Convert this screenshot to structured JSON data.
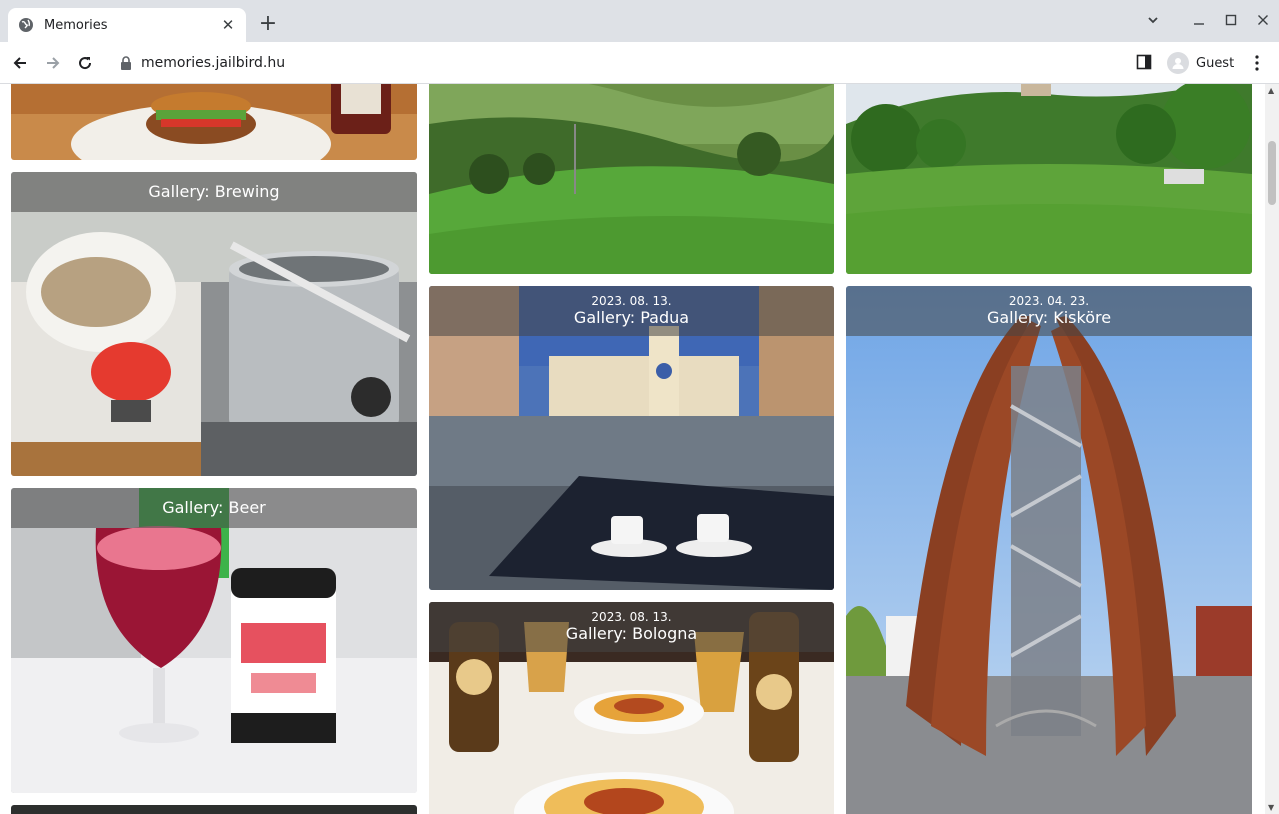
{
  "browser": {
    "tab_title": "Memories",
    "url": "memories.jailbird.hu",
    "profile_name": "Guest",
    "new_tab_label": "+",
    "close_tab_label": "✕"
  },
  "galleries": [
    {
      "id": "food-top",
      "date": "",
      "title": ""
    },
    {
      "id": "brewing",
      "date": "",
      "title": "Gallery: Brewing"
    },
    {
      "id": "beer",
      "date": "",
      "title": "Gallery: Beer"
    },
    {
      "id": "bottom-left",
      "date": "",
      "title": ""
    },
    {
      "id": "mountain-meadow",
      "date": "",
      "title": ""
    },
    {
      "id": "padua",
      "date": "2023. 08. 13.",
      "title": "Gallery: Padua"
    },
    {
      "id": "bologna",
      "date": "2023. 08. 13.",
      "title": "Gallery: Bologna"
    },
    {
      "id": "park",
      "date": "",
      "title": ""
    },
    {
      "id": "kiskore",
      "date": "2023. 04. 23.",
      "title": "Gallery: Kisköre"
    }
  ],
  "colors": {
    "tabbar": "#dee1e6",
    "overlay": "rgba(70,70,70,0.55)",
    "grass": "#4f9a2e",
    "sky": "#8fc0ef"
  }
}
